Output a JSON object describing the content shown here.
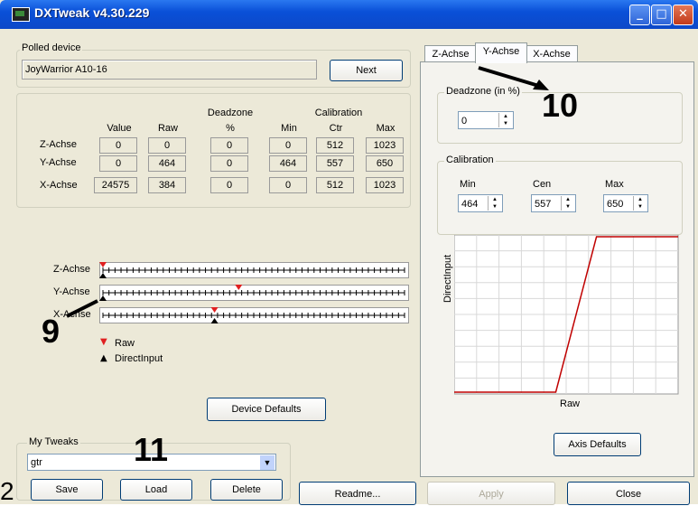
{
  "window": {
    "title": "DXTweak v4.30.229"
  },
  "polled": {
    "label": "Polled device",
    "device": "JoyWarrior A10-16",
    "next": "Next"
  },
  "table": {
    "headers": {
      "value": "Value",
      "raw": "Raw",
      "deadzone": "Deadzone",
      "deadzone_unit": "%",
      "calibration": "Calibration",
      "min": "Min",
      "ctr": "Ctr",
      "max": "Max"
    },
    "rows": [
      {
        "name": "Z-Achse",
        "value": "0",
        "raw": "0",
        "deadzone": "0",
        "min": "0",
        "ctr": "512",
        "max": "1023"
      },
      {
        "name": "Y-Achse",
        "value": "0",
        "raw": "464",
        "deadzone": "0",
        "min": "464",
        "ctr": "557",
        "max": "650"
      },
      {
        "name": "X-Achse",
        "value": "24575",
        "raw": "384",
        "deadzone": "0",
        "min": "0",
        "ctr": "512",
        "max": "1023"
      }
    ]
  },
  "sliders": [
    {
      "name": "Z-Achse",
      "raw_fraction": 0.0,
      "di_fraction": 0.0
    },
    {
      "name": "Y-Achse",
      "raw_fraction": 0.45,
      "di_fraction": 0.0
    },
    {
      "name": "X-Achse",
      "raw_fraction": 0.37,
      "di_fraction": 0.37
    }
  ],
  "legend": {
    "raw": "Raw",
    "directinput": "DirectInput"
  },
  "buttons": {
    "device_defaults": "Device Defaults",
    "save": "Save",
    "load": "Load",
    "delete": "Delete",
    "readme": "Readme...",
    "apply": "Apply",
    "close": "Close",
    "axis_defaults": "Axis Defaults"
  },
  "tweaks": {
    "label": "My Tweaks",
    "value": "gtr"
  },
  "tabs": [
    "Z-Achse",
    "Y-Achse",
    "X-Achse"
  ],
  "axis_panel": {
    "deadzone_label": "Deadzone (in %)",
    "deadzone_value": "0",
    "calibration_label": "Calibration",
    "min_label": "Min",
    "min_value": "464",
    "cen_label": "Cen",
    "cen_value": "557",
    "max_label": "Max",
    "max_value": "650",
    "graph_xlabel": "Raw",
    "graph_ylabel": "DirectInput"
  },
  "annotations": {
    "a9": "9",
    "a10": "10",
    "a11": "11",
    "a2": "2"
  },
  "colors": {
    "raw_marker": "#e02020",
    "di_marker": "#000000",
    "curve": "#c00000"
  }
}
